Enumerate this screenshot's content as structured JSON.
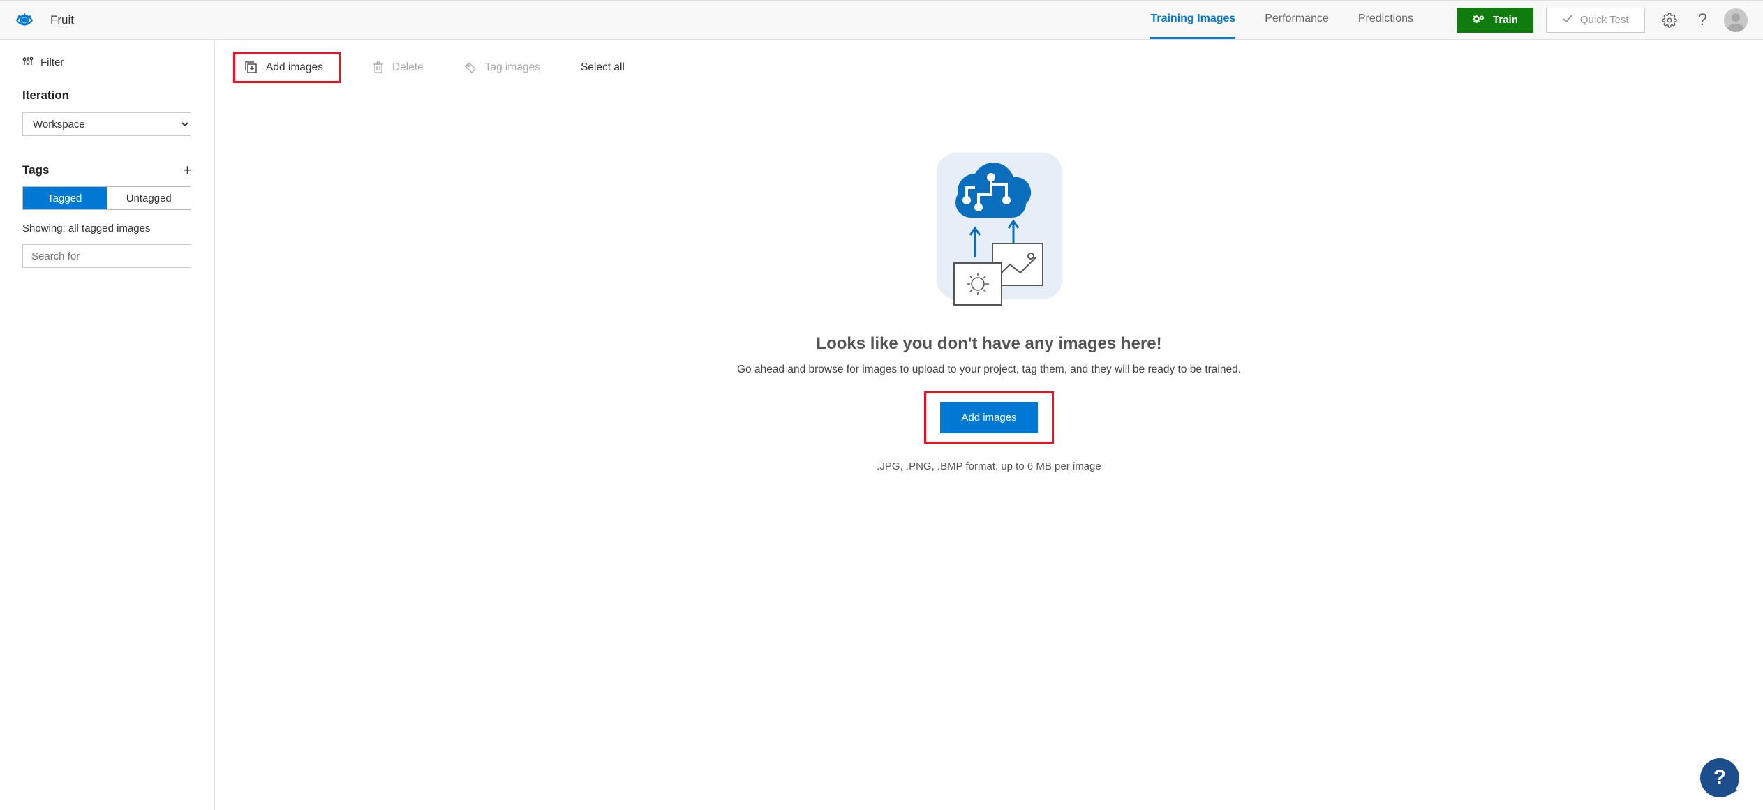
{
  "header": {
    "project_name": "Fruit",
    "tabs": {
      "training_images": "Training Images",
      "performance": "Performance",
      "predictions": "Predictions"
    },
    "train_label": "Train",
    "quick_test_label": "Quick Test"
  },
  "sidebar": {
    "filter_label": "Filter",
    "iteration_label": "Iteration",
    "iteration_value": "Workspace",
    "tags_label": "Tags",
    "tagged_label": "Tagged",
    "untagged_label": "Untagged",
    "showing_text": "Showing: all tagged images",
    "search_placeholder": "Search for"
  },
  "toolbar": {
    "add_images": "Add images",
    "delete": "Delete",
    "tag_images": "Tag images",
    "select_all": "Select all"
  },
  "empty": {
    "heading": "Looks like you don't have any images here!",
    "body": "Go ahead and browse for images to upload to your project, tag them, and they will be ready to be trained.",
    "add_images": "Add images",
    "formats": ".JPG, .PNG, .BMP format, up to 6 MB per image"
  }
}
